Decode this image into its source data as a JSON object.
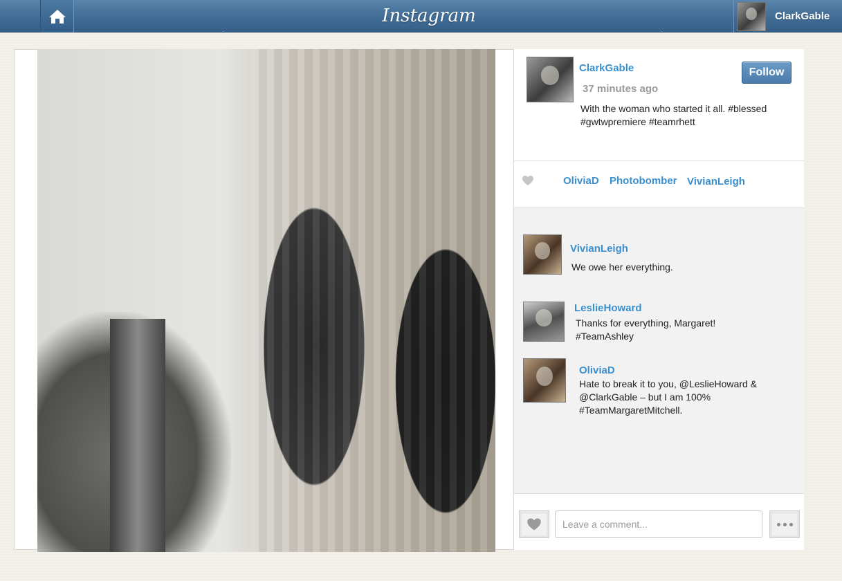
{
  "header": {
    "brand": "Instagram",
    "user_name": "ClarkGable"
  },
  "post": {
    "owner": "ClarkGable",
    "time": "37 minutes ago",
    "caption": "With the woman who started it all. #blessed #gwtwpremiere #teamrhett",
    "follow_label": "Follow"
  },
  "likes": [
    "OliviaD",
    "Photobomber",
    "VivianLeigh"
  ],
  "comments": [
    {
      "user": "VivianLeigh",
      "text": "We owe her everything."
    },
    {
      "user": "LeslieHoward",
      "text": "Thanks for everything, Margaret! #TeamAshley"
    },
    {
      "user": "OliviaD",
      "text": "Hate to break it to you, @LeslieHoward & @ClarkGable – but I am 100% #TeamMargaretMitchell."
    }
  ],
  "comment_box": {
    "placeholder": "Leave a comment..."
  },
  "colors": {
    "link": "#3a8fce",
    "topbar": "#3e6a93"
  },
  "icons": {
    "home": "home-icon",
    "heart": "heart-icon",
    "more": "more-dots-icon"
  }
}
